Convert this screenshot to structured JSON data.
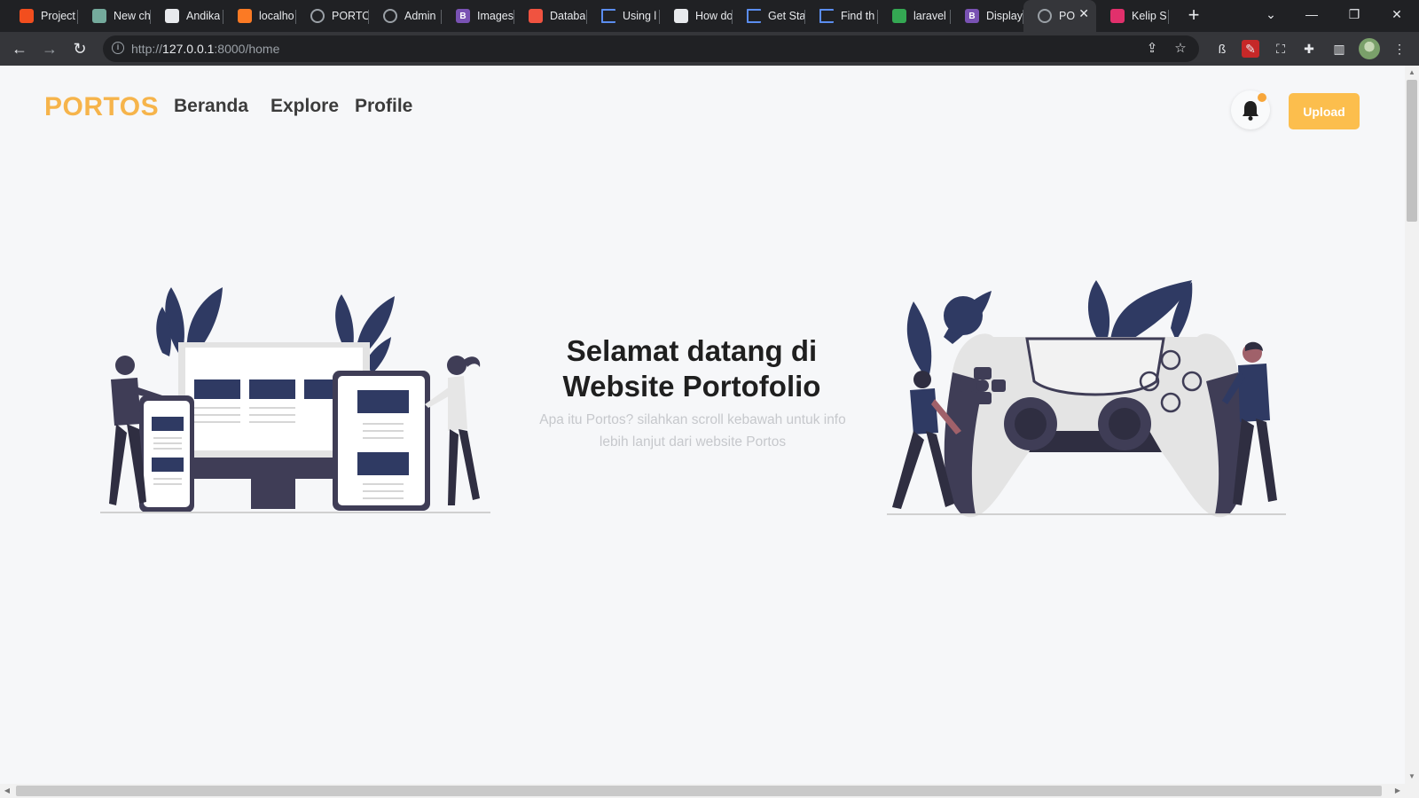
{
  "browser": {
    "tabs": [
      {
        "label": "Project",
        "icon": "figma-icon",
        "color": "#f24e1e",
        "glyph": ""
      },
      {
        "label": "New ch",
        "icon": "chatgpt-icon",
        "color": "#74aa9c",
        "glyph": ""
      },
      {
        "label": "Andika",
        "icon": "github-icon",
        "color": "#e8eaed",
        "glyph": ""
      },
      {
        "label": "localho",
        "icon": "xampp-icon",
        "color": "#fb7a24",
        "glyph": ""
      },
      {
        "label": "PORTO",
        "icon": "globe-icon",
        "color": "#9aa0a6",
        "glyph": ""
      },
      {
        "label": "Admin",
        "icon": "globe-icon",
        "color": "#9aa0a6",
        "glyph": ""
      },
      {
        "label": "Images",
        "icon": "bootstrap-icon",
        "color": "#7952b3",
        "glyph": "B"
      },
      {
        "label": "Databa",
        "icon": "laravel-icon",
        "color": "#f05340",
        "glyph": ""
      },
      {
        "label": "Using l",
        "icon": "flag-icon",
        "color": "#5b8def",
        "glyph": ""
      },
      {
        "label": "How do",
        "icon": "medium-icon",
        "color": "#e8eaed",
        "glyph": ""
      },
      {
        "label": "Get Sta",
        "icon": "flag-icon",
        "color": "#5b8def",
        "glyph": ""
      },
      {
        "label": "Find th",
        "icon": "flag-icon",
        "color": "#5b8def",
        "glyph": ""
      },
      {
        "label": "laravel",
        "icon": "sheets-icon",
        "color": "#34a853",
        "glyph": ""
      },
      {
        "label": "Display",
        "icon": "bootstrap-icon",
        "color": "#7952b3",
        "glyph": "B"
      },
      {
        "label": "PO",
        "icon": "globe-icon",
        "color": "#9aa0a6",
        "glyph": "",
        "active": true
      },
      {
        "label": "Kelip S",
        "icon": "instagram-icon",
        "color": "#e1306c",
        "glyph": ""
      }
    ],
    "url_prefix": "http://",
    "url_host": "127.0.0.1",
    "url_rest": ":8000/home"
  },
  "site": {
    "brand": "PORTOS",
    "nav": {
      "home": "Beranda",
      "explore": "Explore",
      "profile": "Profile"
    },
    "upload_label": "Upload",
    "colors": {
      "brand": "#f6b44b",
      "button": "#fcbe4d",
      "notification_dot": "#f7a63a",
      "illustration_navy": "#2f3a63"
    }
  },
  "hero": {
    "title_line1": "Selamat datang di",
    "title_line2": "Website Portofolio",
    "subtitle_line1": "Apa itu Portos? silahkan scroll kebawah untuk info",
    "subtitle_line2": "lebih lanjut dari website Portos"
  }
}
